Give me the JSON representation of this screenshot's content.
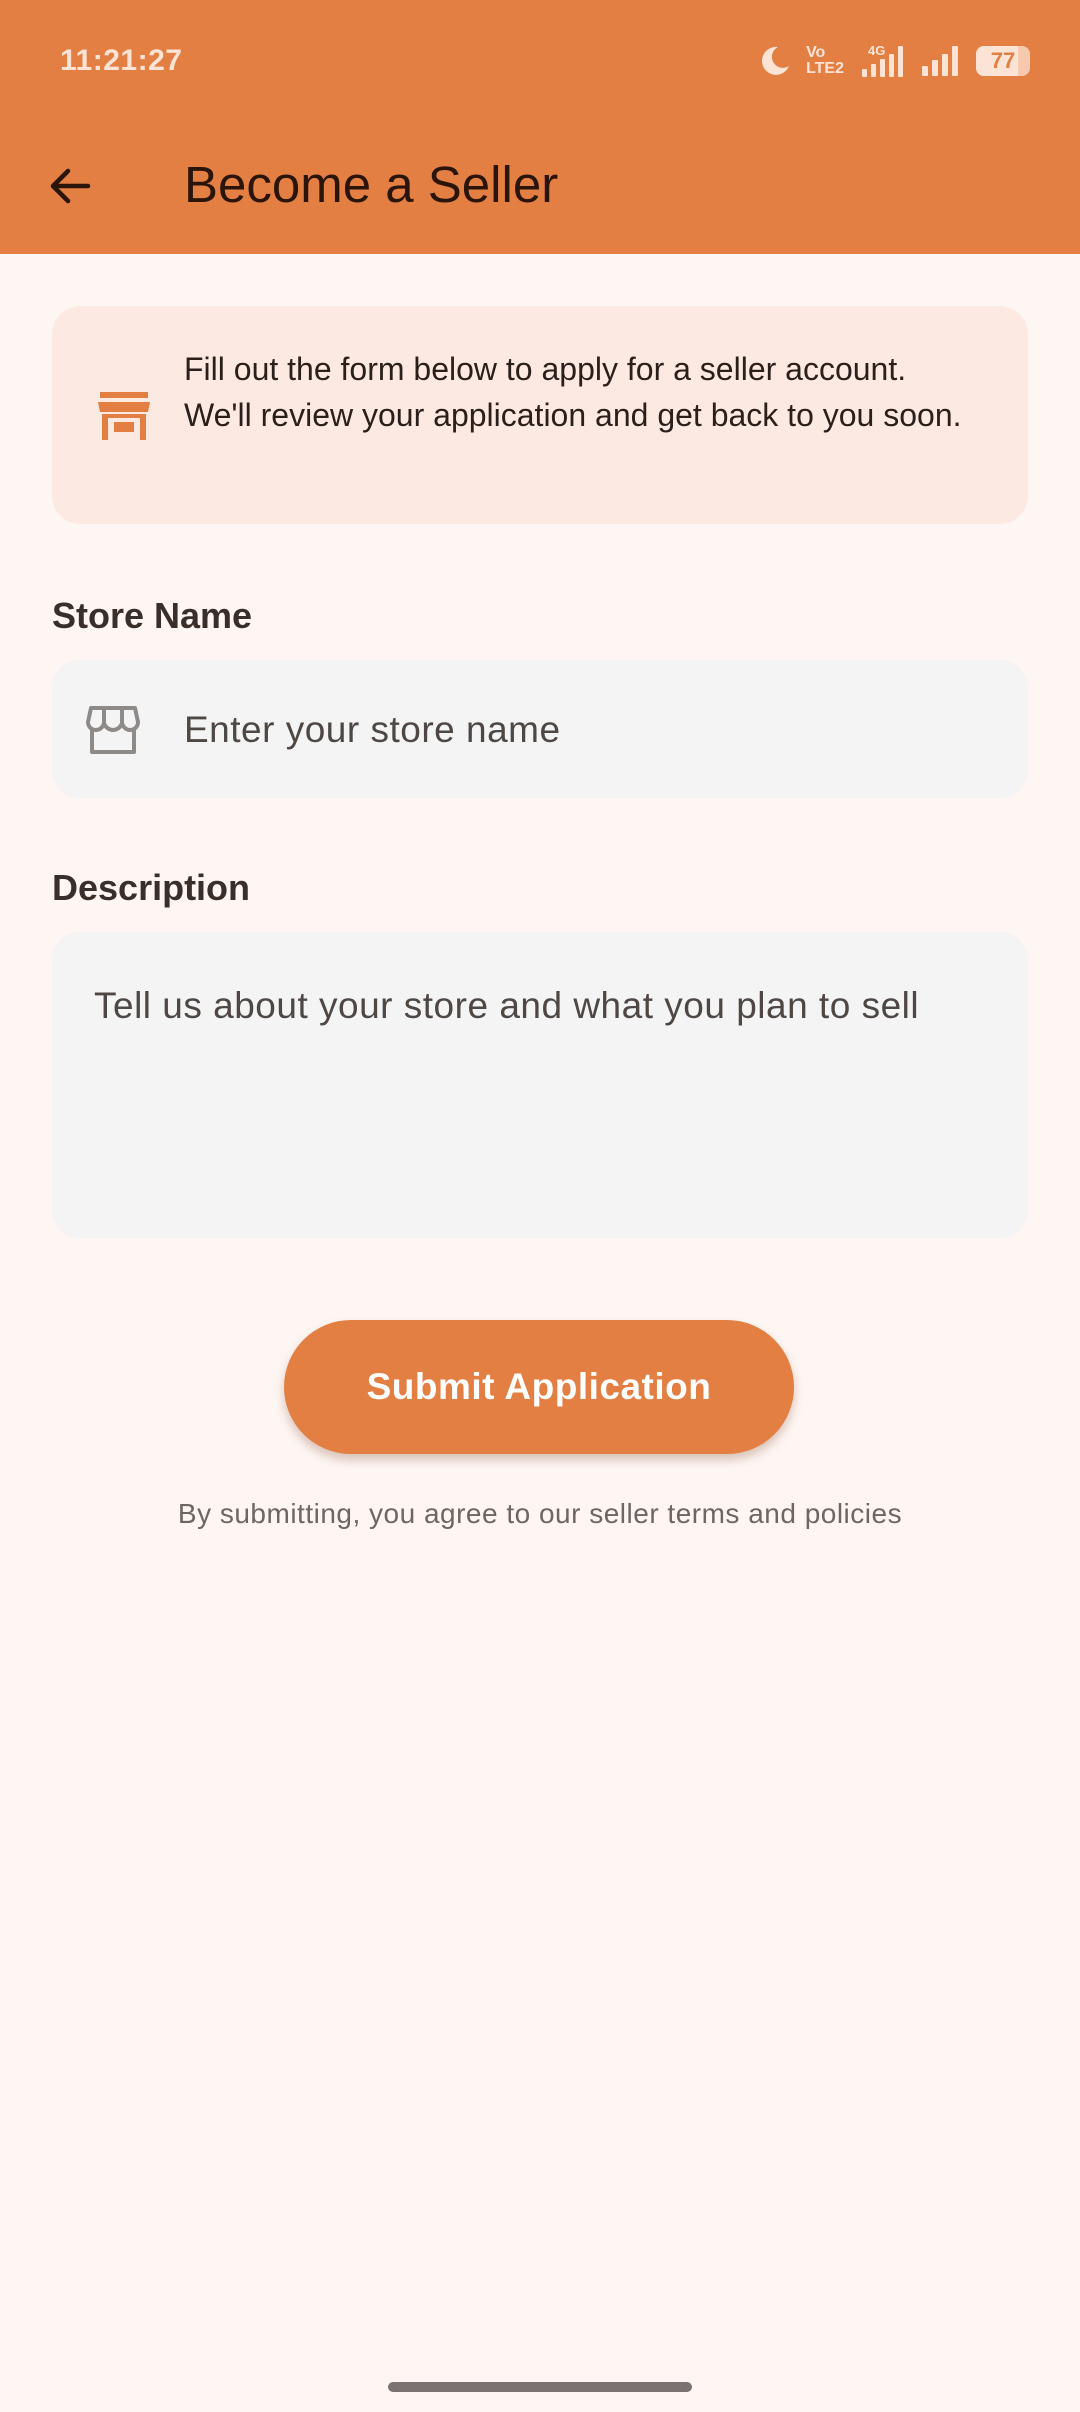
{
  "status_bar": {
    "time": "11:21:27",
    "network_volte_top": "Vo",
    "network_volte_bottom": "LTE2",
    "network_type": "4G",
    "battery_level": "77",
    "battery_fraction": 0.77,
    "icons": [
      "moon-icon",
      "volte-icon",
      "signal-4g-icon",
      "signal-icon",
      "battery-icon"
    ]
  },
  "app_bar": {
    "title": "Become a Seller",
    "back_icon": "arrow-back-icon"
  },
  "info_card": {
    "icon": "storefront-icon",
    "text": "Fill out the form below to apply for a seller account. We'll review your application and get back to you soon."
  },
  "form": {
    "store_name": {
      "label": "Store Name",
      "placeholder": "Enter your store name",
      "value": "",
      "icon": "store-icon"
    },
    "description": {
      "label": "Description",
      "placeholder": "Tell us about your store and what you plan to sell",
      "value": ""
    },
    "submit_label": "Submit Application",
    "terms_text": "By submitting, you agree to our seller terms and policies"
  },
  "colors": {
    "primary": "#E37F43",
    "background": "#FEF6F3",
    "info_card_bg": "#FCEAE2",
    "input_bg": "#F4F4F5"
  }
}
